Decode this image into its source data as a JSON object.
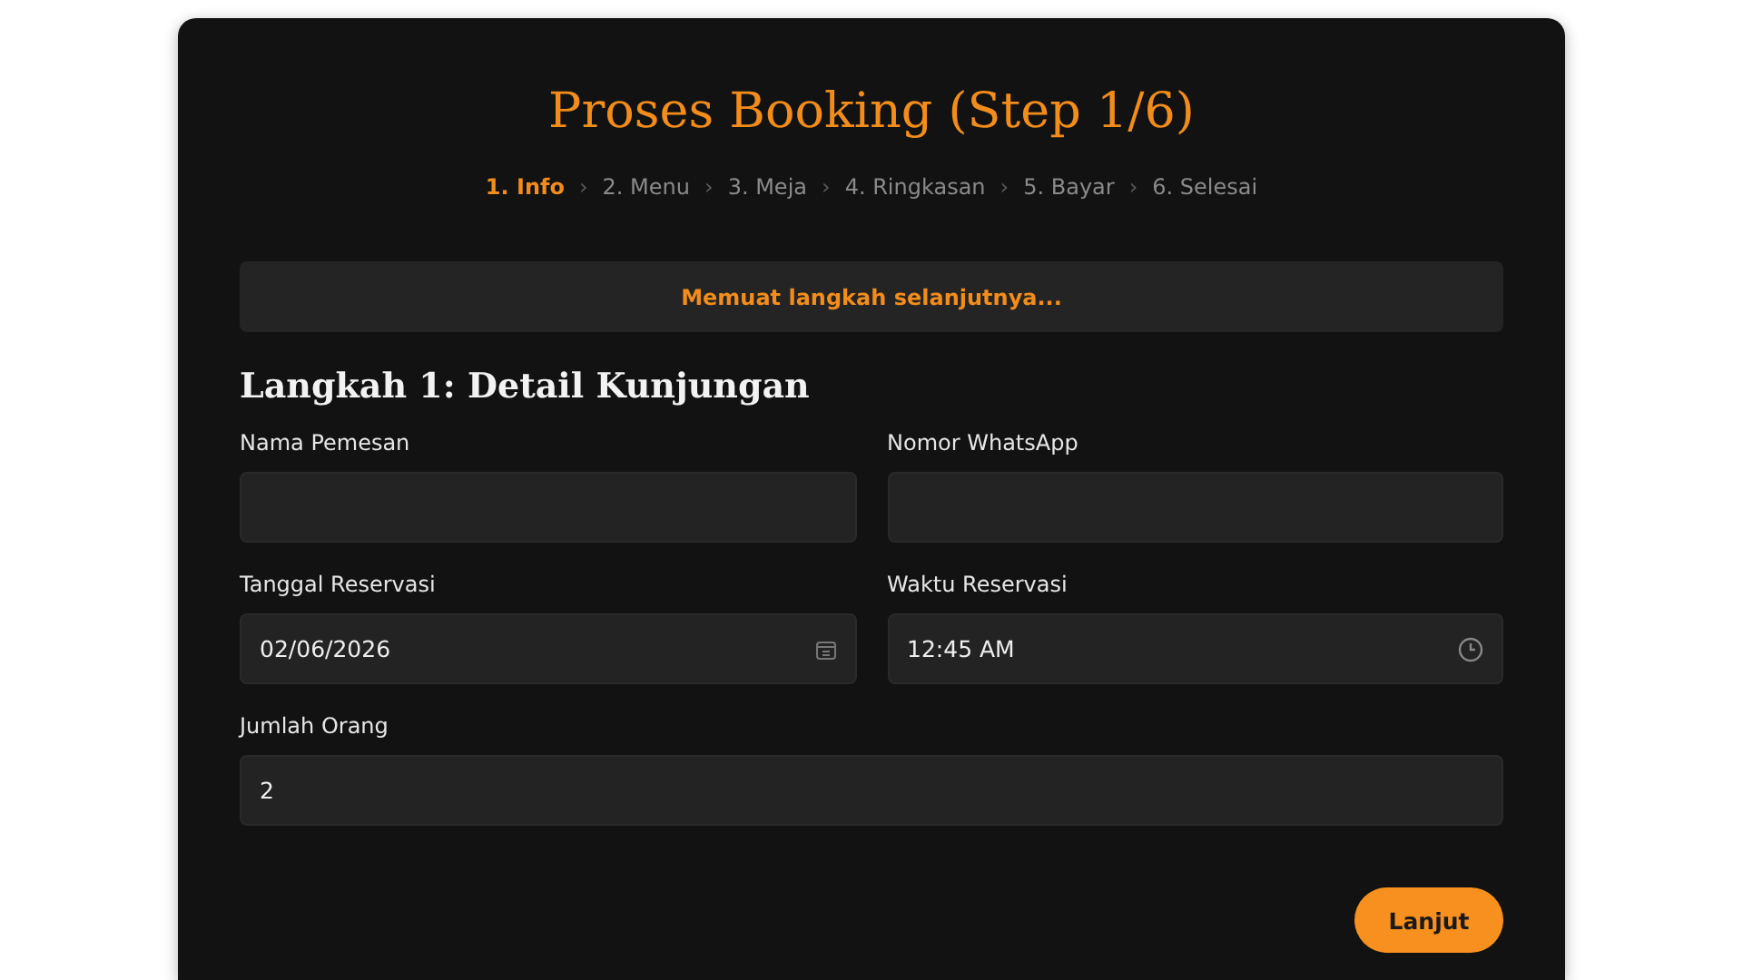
{
  "title": "Proses Booking (Step 1/6)",
  "steps": [
    {
      "label": "1. Info",
      "selected": true
    },
    {
      "label": "2. Menu",
      "selected": false
    },
    {
      "label": "3. Meja",
      "selected": false
    },
    {
      "label": "4. Ringkasan",
      "selected": false
    },
    {
      "label": "5. Bayar",
      "selected": false
    },
    {
      "label": "6. Selesai",
      "selected": false
    }
  ],
  "step_separator": "›",
  "banner": "Memuat langkah selanjutnya...",
  "section_title": "Langkah 1: Detail Kunjungan",
  "fields": [
    {
      "label": "Nama Pemesan",
      "kind": "text"
    },
    {
      "label": "Nomor WhatsApp",
      "kind": "text"
    },
    {
      "label": "Tanggal Reservasi",
      "value": "02/06/2026",
      "kind": "date"
    },
    {
      "label": "Waktu Reservasi",
      "value": "12:45 AM",
      "kind": "time"
    },
    {
      "label": "Jumlah Orang",
      "value": "2",
      "kind": "wide"
    }
  ],
  "next_button": "Lanjut"
}
